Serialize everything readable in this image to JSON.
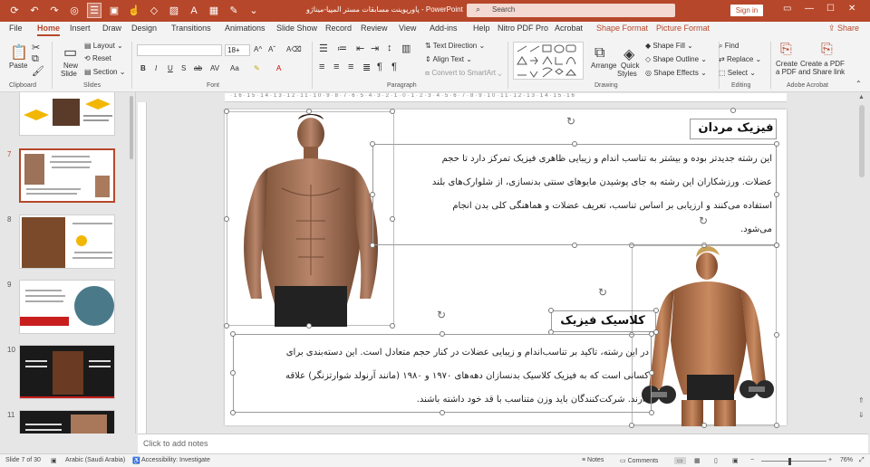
{
  "titlebar": {
    "doc_title": "پاورپوینت مسابقات مستر المپیا-میناژو",
    "app_name": "PowerPoint",
    "search_placeholder": "Search",
    "sign_in": "Sign in"
  },
  "menu": {
    "tabs": [
      "File",
      "Home",
      "Insert",
      "Draw",
      "Design",
      "Transitions",
      "Animations",
      "Slide Show",
      "Record",
      "Review",
      "View",
      "Add-ins",
      "Help",
      "Nitro PDF Pro",
      "Acrobat",
      "Shape Format",
      "Picture Format"
    ],
    "active": "Home",
    "share": "Share"
  },
  "ribbon": {
    "clipboard": {
      "paste": "Paste",
      "label": "Clipboard"
    },
    "slides": {
      "new_slide": "New",
      "new_slide2": "Slide",
      "layout": "Layout",
      "reset": "Reset",
      "section": "Section",
      "label": "Slides"
    },
    "font": {
      "size": "18+",
      "label": "Font"
    },
    "paragraph": {
      "text_direction": "Text Direction",
      "align_text": "Align Text",
      "convert_smartart": "Convert to SmartArt",
      "label": "Paragraph"
    },
    "drawing": {
      "arrange": "Arrange",
      "quick_styles": "Quick",
      "quick_styles2": "Styles",
      "shape_fill": "Shape Fill",
      "shape_outline": "Shape Outline",
      "shape_effects": "Shape Effects",
      "label": "Drawing"
    },
    "editing": {
      "find": "Find",
      "replace": "Replace",
      "select": "Select",
      "label": "Editing"
    },
    "acrobat": {
      "create_pdf": "Create",
      "create_pdf2": "a PDF",
      "create_share": "Create a PDF",
      "create_share2": "and Share link",
      "label": "Adobe Acrobat"
    }
  },
  "thumbnails": [
    {
      "num": "7"
    },
    {
      "num": "8"
    },
    {
      "num": "9"
    },
    {
      "num": "10"
    },
    {
      "num": "11"
    }
  ],
  "slide": {
    "heading1": "فیزیک مردان",
    "para1_lines": [
      "این رشته جدیدتر بوده و بیشتر به تناسب اندام و زیبایی ظاهری فیزیک تمرکز دارد تا حجم",
      "عضلات. ورزشکاران این رشته به جای پوشیدن مایوهای سنتی بدنسازی، از شلوارک‌های بلند",
      "استفاده می‌کنند و ارزیابی بر اساس تناسب، تعریف عضلات و هماهنگی کلی بدن انجام",
      "می‌شود."
    ],
    "heading2": "کلاسیک فیزیک",
    "para2_lines": [
      "در این رشته، تاکید بر تناسب‌اندام و زیبایی عضلات در کنار حجم متعادل است. این دسته‌بندی برای",
      "کسانی است که به فیزیک کلاسیک بدنسازان دهه‌های ۱۹۷۰ و ۱۹۸۰ (مانند آرنولد شوارتزنگر) علاقه",
      "دارند. شرکت‌کنندگان باید وزن متناسب با قد خود داشته باشند."
    ]
  },
  "notes_placeholder": "Click to add notes",
  "status": {
    "slide_info": "Slide 7 of 30",
    "language": "Arabic (Saudi Arabia)",
    "accessibility": "Accessibility: Investigate",
    "notes": "Notes",
    "comments": "Comments",
    "zoom": "76%"
  },
  "colors": {
    "accent": "#b7472a"
  }
}
